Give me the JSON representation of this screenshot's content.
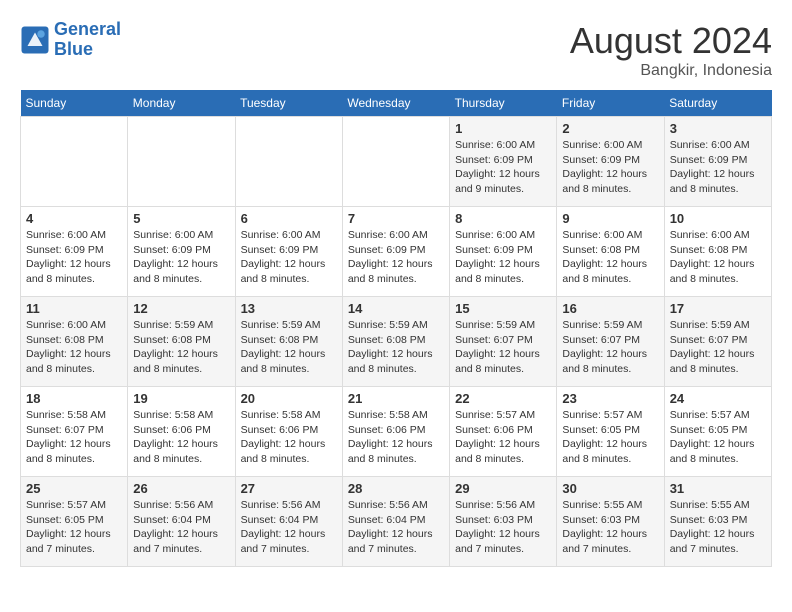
{
  "logo": {
    "line1": "General",
    "line2": "Blue"
  },
  "title": "August 2024",
  "location": "Bangkir, Indonesia",
  "days_of_week": [
    "Sunday",
    "Monday",
    "Tuesday",
    "Wednesday",
    "Thursday",
    "Friday",
    "Saturday"
  ],
  "weeks": [
    [
      {
        "day": "",
        "info": ""
      },
      {
        "day": "",
        "info": ""
      },
      {
        "day": "",
        "info": ""
      },
      {
        "day": "",
        "info": ""
      },
      {
        "day": "1",
        "info": "Sunrise: 6:00 AM\nSunset: 6:09 PM\nDaylight: 12 hours\nand 9 minutes."
      },
      {
        "day": "2",
        "info": "Sunrise: 6:00 AM\nSunset: 6:09 PM\nDaylight: 12 hours\nand 8 minutes."
      },
      {
        "day": "3",
        "info": "Sunrise: 6:00 AM\nSunset: 6:09 PM\nDaylight: 12 hours\nand 8 minutes."
      }
    ],
    [
      {
        "day": "4",
        "info": "Sunrise: 6:00 AM\nSunset: 6:09 PM\nDaylight: 12 hours\nand 8 minutes."
      },
      {
        "day": "5",
        "info": "Sunrise: 6:00 AM\nSunset: 6:09 PM\nDaylight: 12 hours\nand 8 minutes."
      },
      {
        "day": "6",
        "info": "Sunrise: 6:00 AM\nSunset: 6:09 PM\nDaylight: 12 hours\nand 8 minutes."
      },
      {
        "day": "7",
        "info": "Sunrise: 6:00 AM\nSunset: 6:09 PM\nDaylight: 12 hours\nand 8 minutes."
      },
      {
        "day": "8",
        "info": "Sunrise: 6:00 AM\nSunset: 6:09 PM\nDaylight: 12 hours\nand 8 minutes."
      },
      {
        "day": "9",
        "info": "Sunrise: 6:00 AM\nSunset: 6:08 PM\nDaylight: 12 hours\nand 8 minutes."
      },
      {
        "day": "10",
        "info": "Sunrise: 6:00 AM\nSunset: 6:08 PM\nDaylight: 12 hours\nand 8 minutes."
      }
    ],
    [
      {
        "day": "11",
        "info": "Sunrise: 6:00 AM\nSunset: 6:08 PM\nDaylight: 12 hours\nand 8 minutes."
      },
      {
        "day": "12",
        "info": "Sunrise: 5:59 AM\nSunset: 6:08 PM\nDaylight: 12 hours\nand 8 minutes."
      },
      {
        "day": "13",
        "info": "Sunrise: 5:59 AM\nSunset: 6:08 PM\nDaylight: 12 hours\nand 8 minutes."
      },
      {
        "day": "14",
        "info": "Sunrise: 5:59 AM\nSunset: 6:08 PM\nDaylight: 12 hours\nand 8 minutes."
      },
      {
        "day": "15",
        "info": "Sunrise: 5:59 AM\nSunset: 6:07 PM\nDaylight: 12 hours\nand 8 minutes."
      },
      {
        "day": "16",
        "info": "Sunrise: 5:59 AM\nSunset: 6:07 PM\nDaylight: 12 hours\nand 8 minutes."
      },
      {
        "day": "17",
        "info": "Sunrise: 5:59 AM\nSunset: 6:07 PM\nDaylight: 12 hours\nand 8 minutes."
      }
    ],
    [
      {
        "day": "18",
        "info": "Sunrise: 5:58 AM\nSunset: 6:07 PM\nDaylight: 12 hours\nand 8 minutes."
      },
      {
        "day": "19",
        "info": "Sunrise: 5:58 AM\nSunset: 6:06 PM\nDaylight: 12 hours\nand 8 minutes."
      },
      {
        "day": "20",
        "info": "Sunrise: 5:58 AM\nSunset: 6:06 PM\nDaylight: 12 hours\nand 8 minutes."
      },
      {
        "day": "21",
        "info": "Sunrise: 5:58 AM\nSunset: 6:06 PM\nDaylight: 12 hours\nand 8 minutes."
      },
      {
        "day": "22",
        "info": "Sunrise: 5:57 AM\nSunset: 6:06 PM\nDaylight: 12 hours\nand 8 minutes."
      },
      {
        "day": "23",
        "info": "Sunrise: 5:57 AM\nSunset: 6:05 PM\nDaylight: 12 hours\nand 8 minutes."
      },
      {
        "day": "24",
        "info": "Sunrise: 5:57 AM\nSunset: 6:05 PM\nDaylight: 12 hours\nand 8 minutes."
      }
    ],
    [
      {
        "day": "25",
        "info": "Sunrise: 5:57 AM\nSunset: 6:05 PM\nDaylight: 12 hours\nand 7 minutes."
      },
      {
        "day": "26",
        "info": "Sunrise: 5:56 AM\nSunset: 6:04 PM\nDaylight: 12 hours\nand 7 minutes."
      },
      {
        "day": "27",
        "info": "Sunrise: 5:56 AM\nSunset: 6:04 PM\nDaylight: 12 hours\nand 7 minutes."
      },
      {
        "day": "28",
        "info": "Sunrise: 5:56 AM\nSunset: 6:04 PM\nDaylight: 12 hours\nand 7 minutes."
      },
      {
        "day": "29",
        "info": "Sunrise: 5:56 AM\nSunset: 6:03 PM\nDaylight: 12 hours\nand 7 minutes."
      },
      {
        "day": "30",
        "info": "Sunrise: 5:55 AM\nSunset: 6:03 PM\nDaylight: 12 hours\nand 7 minutes."
      },
      {
        "day": "31",
        "info": "Sunrise: 5:55 AM\nSunset: 6:03 PM\nDaylight: 12 hours\nand 7 minutes."
      }
    ]
  ]
}
